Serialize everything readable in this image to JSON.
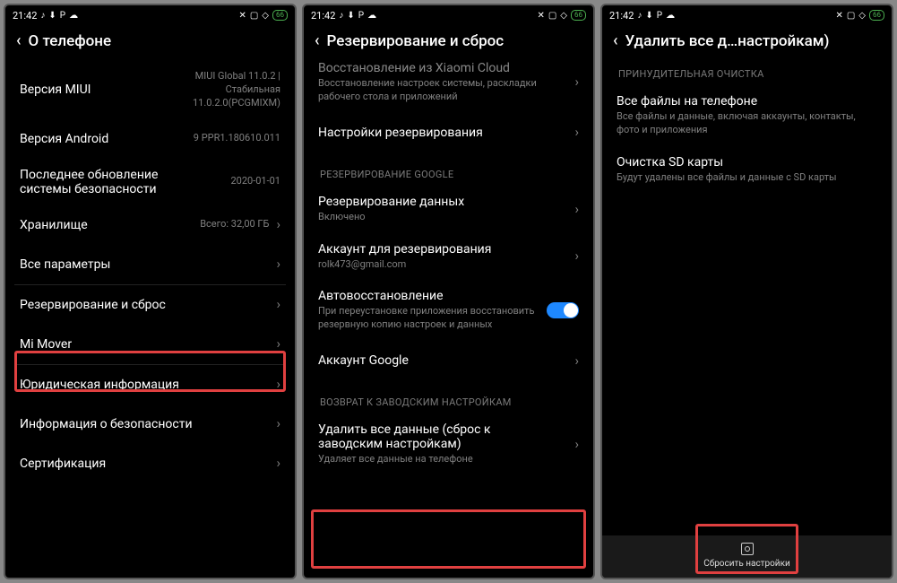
{
  "status": {
    "time": "21:42",
    "battery": "66"
  },
  "screen1": {
    "title": "О телефоне",
    "miui": {
      "label": "Версия MIUI",
      "value1": "MIUI Global 11.0.2 |",
      "value2": "Стабильная",
      "value3": "11.0.2.0(PCGMIXM)"
    },
    "android": {
      "label": "Версия Android",
      "value": "9 PPR1.180610.011"
    },
    "security": {
      "label1": "Последнее обновление",
      "label2": "системы безопасности",
      "value": "2020-01-01"
    },
    "storage": {
      "label": "Хранилище",
      "value": "Всего: 32,00 ГБ"
    },
    "allparams": {
      "label": "Все параметры"
    },
    "backup": {
      "label": "Резервирование и сброс"
    },
    "mimover": {
      "label": "Mi Mover"
    },
    "legal": {
      "label": "Юридическая информация"
    },
    "safety": {
      "label": "Информация о безопасности"
    },
    "cert": {
      "label": "Сертификация"
    }
  },
  "screen2": {
    "title": "Резервирование и сброс",
    "xiaomi": {
      "title": "Восстановление из Xiaomi Cloud",
      "sub": "Восстановление настроек системы, раскладки рабочего стола и приложений"
    },
    "backup_settings": {
      "title": "Настройки резервирования"
    },
    "sec_google": "РЕЗЕРВИРОВАНИЕ GOOGLE",
    "gbackup": {
      "title": "Резервирование данных",
      "sub": "Включено"
    },
    "gaccount": {
      "title": "Аккаунт для резервирования",
      "sub": "rolk473@gmail.com"
    },
    "auto": {
      "title": "Автовосстановление",
      "sub": "При переустановке приложения восстановить резервную копию настроек и данных"
    },
    "google": {
      "title": "Аккаунт Google"
    },
    "sec_reset": "ВОЗВРАТ К ЗАВОДСКИМ НАСТРОЙКАМ",
    "erase": {
      "title1": "Удалить все данные (сброс к",
      "title2": "заводским настройкам)",
      "sub": "Удаляет все данные на телефоне"
    }
  },
  "screen3": {
    "title": "Удалить все д…настройкам)",
    "sec_force": "ПРИНУДИТЕЛЬНАЯ ОЧИСТКА",
    "allfiles": {
      "title": "Все файлы на телефоне",
      "sub": "Все файлы и данные, включая аккаунты, контакты, фото и приложения"
    },
    "sd": {
      "title": "Очистка SD карты",
      "sub": "Будут удалены все файлы и данные с SD карты"
    },
    "bottom": "Сбросить настройки"
  }
}
